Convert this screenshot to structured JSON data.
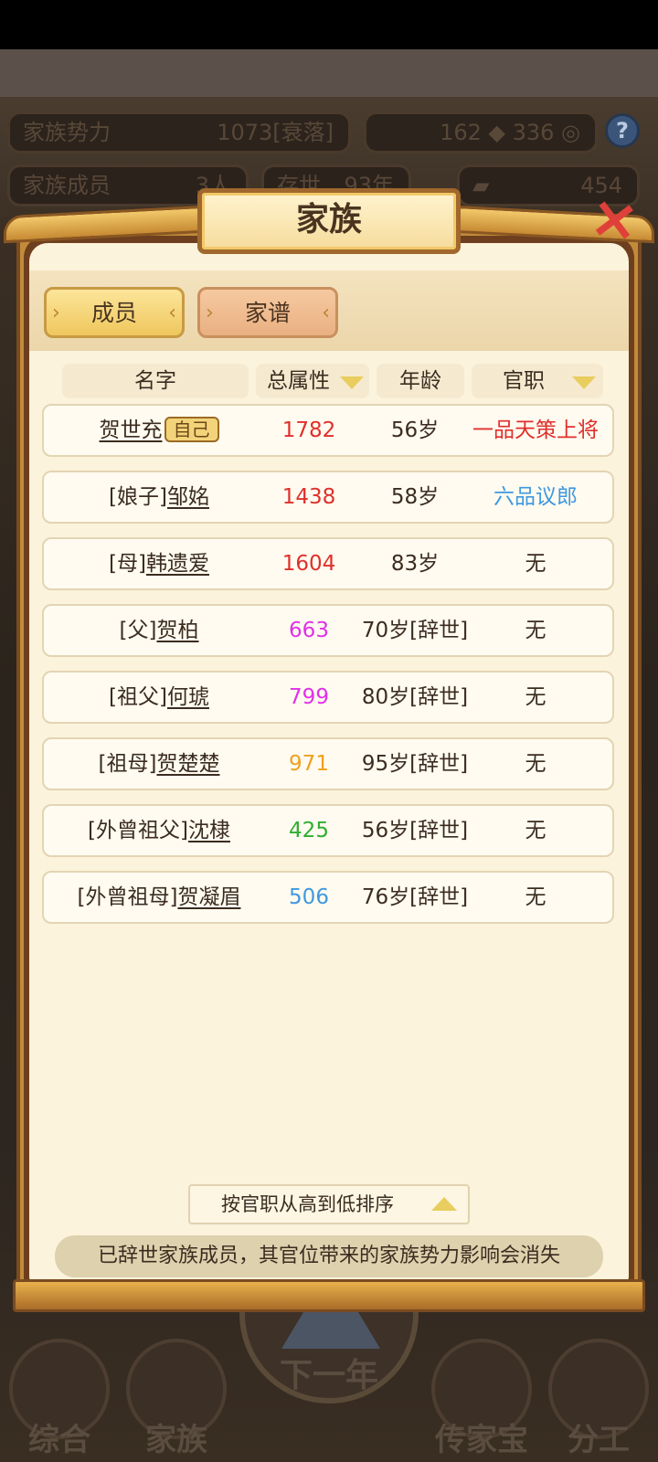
{
  "hud": {
    "power_label": "家族势力",
    "power_value": "1073",
    "power_status": "[衰落]",
    "currency1": "162",
    "currency2": "336",
    "members_label": "家族成员",
    "members_value": "3人",
    "exist_label": "存世",
    "exist_value": "93年",
    "gold_value": "454",
    "help": "?"
  },
  "modal": {
    "title": "家族",
    "close_icon": "×"
  },
  "tabs": [
    {
      "label": "成员",
      "active": true
    },
    {
      "label": "家谱",
      "active": false
    }
  ],
  "columns": {
    "name": "名字",
    "attr": "总属性",
    "age": "年龄",
    "office": "官职"
  },
  "members": [
    {
      "prefix": "",
      "name": "贺世充",
      "badge": "自己",
      "attr": "1782",
      "attr_color": "#e0302c",
      "age": "56岁",
      "office": "一品天策上将",
      "office_color": "#e0302c"
    },
    {
      "prefix": "[娘子]",
      "name": "邹姳",
      "badge": "",
      "attr": "1438",
      "attr_color": "#e0302c",
      "age": "58岁",
      "office": "六品议郎",
      "office_color": "#3f98e0"
    },
    {
      "prefix": "[母]",
      "name": "韩遗爱",
      "badge": "",
      "attr": "1604",
      "attr_color": "#e0302c",
      "age": "83岁",
      "office": "无",
      "office_color": "#3b2c20"
    },
    {
      "prefix": "[父]",
      "name": "贺柏",
      "badge": "",
      "attr": "663",
      "attr_color": "#e030e8",
      "age": "70岁[辞世]",
      "office": "无",
      "office_color": "#3b2c20"
    },
    {
      "prefix": "[祖父]",
      "name": "何琥",
      "badge": "",
      "attr": "799",
      "attr_color": "#e030e8",
      "age": "80岁[辞世]",
      "office": "无",
      "office_color": "#3b2c20"
    },
    {
      "prefix": "[祖母]",
      "name": "贺楚楚",
      "badge": "",
      "attr": "971",
      "attr_color": "#f0a020",
      "age": "95岁[辞世]",
      "office": "无",
      "office_color": "#3b2c20"
    },
    {
      "prefix": "[外曾祖父]",
      "name": "沈棣",
      "badge": "",
      "attr": "425",
      "attr_color": "#2fae2f",
      "age": "56岁[辞世]",
      "office": "无",
      "office_color": "#3b2c20"
    },
    {
      "prefix": "[外曾祖母]",
      "name": "贺凝眉",
      "badge": "",
      "attr": "506",
      "attr_color": "#3f98e0",
      "age": "76岁[辞世]",
      "office": "无",
      "office_color": "#3b2c20"
    }
  ],
  "sort_label": "按官职从高到低排序",
  "notice": "已辞世家族成员，其官位带来的家族势力影响会消失",
  "bottom_nav": [
    {
      "label": "综合",
      "icon": "scroll-icon"
    },
    {
      "label": "家族",
      "icon": "house-icon"
    },
    {
      "label": "下一年",
      "icon": "mountain-icon"
    },
    {
      "label": "传家宝",
      "icon": "treasure-icon"
    },
    {
      "label": "分工",
      "icon": "person-icon"
    }
  ]
}
